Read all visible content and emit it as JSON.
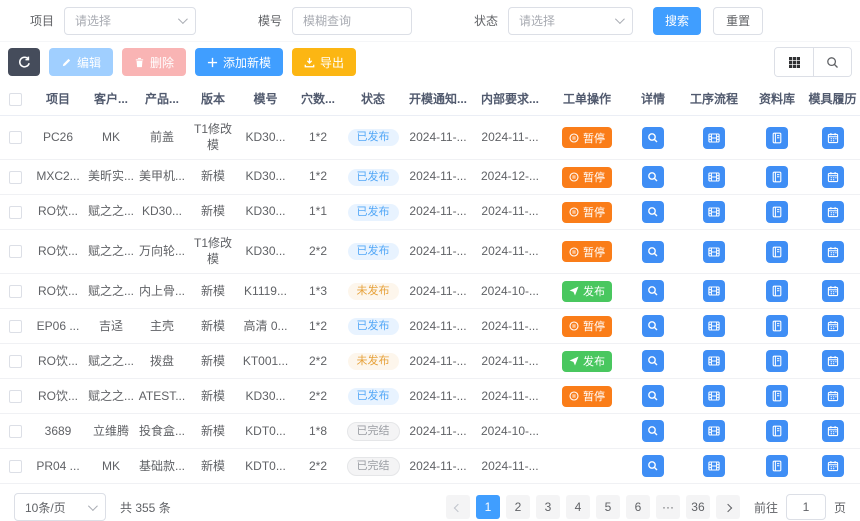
{
  "colors": {
    "primary": "#409eff",
    "dark": "#454c5b",
    "pause": "#fa7d19",
    "publish": "#49c75f",
    "export": "#fcb613",
    "edit-dis": "#a0cfff",
    "del-dis": "#f9b4b4"
  },
  "filters": {
    "project_label": "项目",
    "project_placeholder": "请选择",
    "model_label": "模号",
    "model_placeholder": "模糊查询",
    "status_label": "状态",
    "status_placeholder": "请选择",
    "search_label": "搜索",
    "reset_label": "重置"
  },
  "toolbar": {
    "refresh_icon": "refresh-icon",
    "edit_label": "编辑",
    "delete_label": "删除",
    "add_label": "添加新模",
    "export_label": "导出"
  },
  "table": {
    "headers": [
      "项目",
      "客户...",
      "产品...",
      "版本",
      "模号",
      "穴数...",
      "状态",
      "开模通知...",
      "内部要求...",
      "工单操作",
      "详情",
      "工序流程",
      "资料库",
      "模具履历"
    ],
    "pause_label": "暂停",
    "publish_label": "发布",
    "rows": [
      {
        "project": "PC26",
        "customer": "MK",
        "product": "前盖",
        "version": "T1修改模",
        "model": "KD30...",
        "cavity": "1*2",
        "status": "已发布",
        "status_type": "published",
        "notice_date": "2024-11-...",
        "internal_date": "2024-11-...",
        "work_order": "pause"
      },
      {
        "project": "MXC2...",
        "customer": "美昕实...",
        "product": "美甲机...",
        "version": "新模",
        "model": "KD30...",
        "cavity": "1*2",
        "status": "已发布",
        "status_type": "published",
        "notice_date": "2024-11-...",
        "internal_date": "2024-12-...",
        "work_order": "pause"
      },
      {
        "project": "RO饮...",
        "customer": "赋之之...",
        "product": "KD30...",
        "version": "新模",
        "model": "KD30...",
        "cavity": "1*1",
        "status": "已发布",
        "status_type": "published",
        "notice_date": "2024-11-...",
        "internal_date": "2024-11-...",
        "work_order": "pause"
      },
      {
        "project": "RO饮...",
        "customer": "赋之之...",
        "product": "万向轮...",
        "version": "T1修改模",
        "model": "KD30...",
        "cavity": "2*2",
        "status": "已发布",
        "status_type": "published",
        "notice_date": "2024-11-...",
        "internal_date": "2024-11-...",
        "work_order": "pause"
      },
      {
        "project": "RO饮...",
        "customer": "赋之之...",
        "product": "内上骨...",
        "version": "新模",
        "model": "K1119...",
        "cavity": "1*3",
        "status": "未发布",
        "status_type": "unpublished",
        "notice_date": "2024-11-...",
        "internal_date": "2024-10-...",
        "work_order": "publish"
      },
      {
        "project": "EP06 ...",
        "customer": "吉迳",
        "product": "主壳",
        "version": "新模",
        "model": "高清 0...",
        "cavity": "1*2",
        "status": "已发布",
        "status_type": "published",
        "notice_date": "2024-11-...",
        "internal_date": "2024-11-...",
        "work_order": "pause"
      },
      {
        "project": "RO饮...",
        "customer": "赋之之...",
        "product": "拨盘",
        "version": "新模",
        "model": "KT001...",
        "cavity": "2*2",
        "status": "未发布",
        "status_type": "unpublished",
        "notice_date": "2024-11-...",
        "internal_date": "2024-11-...",
        "work_order": "publish"
      },
      {
        "project": "RO饮...",
        "customer": "赋之之...",
        "product": "ATEST...",
        "version": "新模",
        "model": "KD30...",
        "cavity": "2*2",
        "status": "已发布",
        "status_type": "published",
        "notice_date": "2024-11-...",
        "internal_date": "2024-11-...",
        "work_order": "pause"
      },
      {
        "project": "3689",
        "customer": "立维腾",
        "product": "投食盒...",
        "version": "新模",
        "model": "KDT0...",
        "cavity": "1*8",
        "status": "已完结",
        "status_type": "finished",
        "notice_date": "2024-11-...",
        "internal_date": "2024-10-...",
        "work_order": ""
      },
      {
        "project": "PR04 ...",
        "customer": "MK",
        "product": "基础款...",
        "version": "新模",
        "model": "KDT0...",
        "cavity": "2*2",
        "status": "已完结",
        "status_type": "finished",
        "notice_date": "2024-11-...",
        "internal_date": "2024-11-...",
        "work_order": ""
      }
    ]
  },
  "pagination": {
    "page_size_label": "10条/页",
    "total_label": "共 355 条",
    "pages": [
      "1",
      "2",
      "3",
      "4",
      "5",
      "6",
      "···",
      "36"
    ],
    "active_page": "1",
    "ellipsis_label": "···",
    "goto_label": "前往",
    "goto_value": "1",
    "goto_unit": "页"
  }
}
